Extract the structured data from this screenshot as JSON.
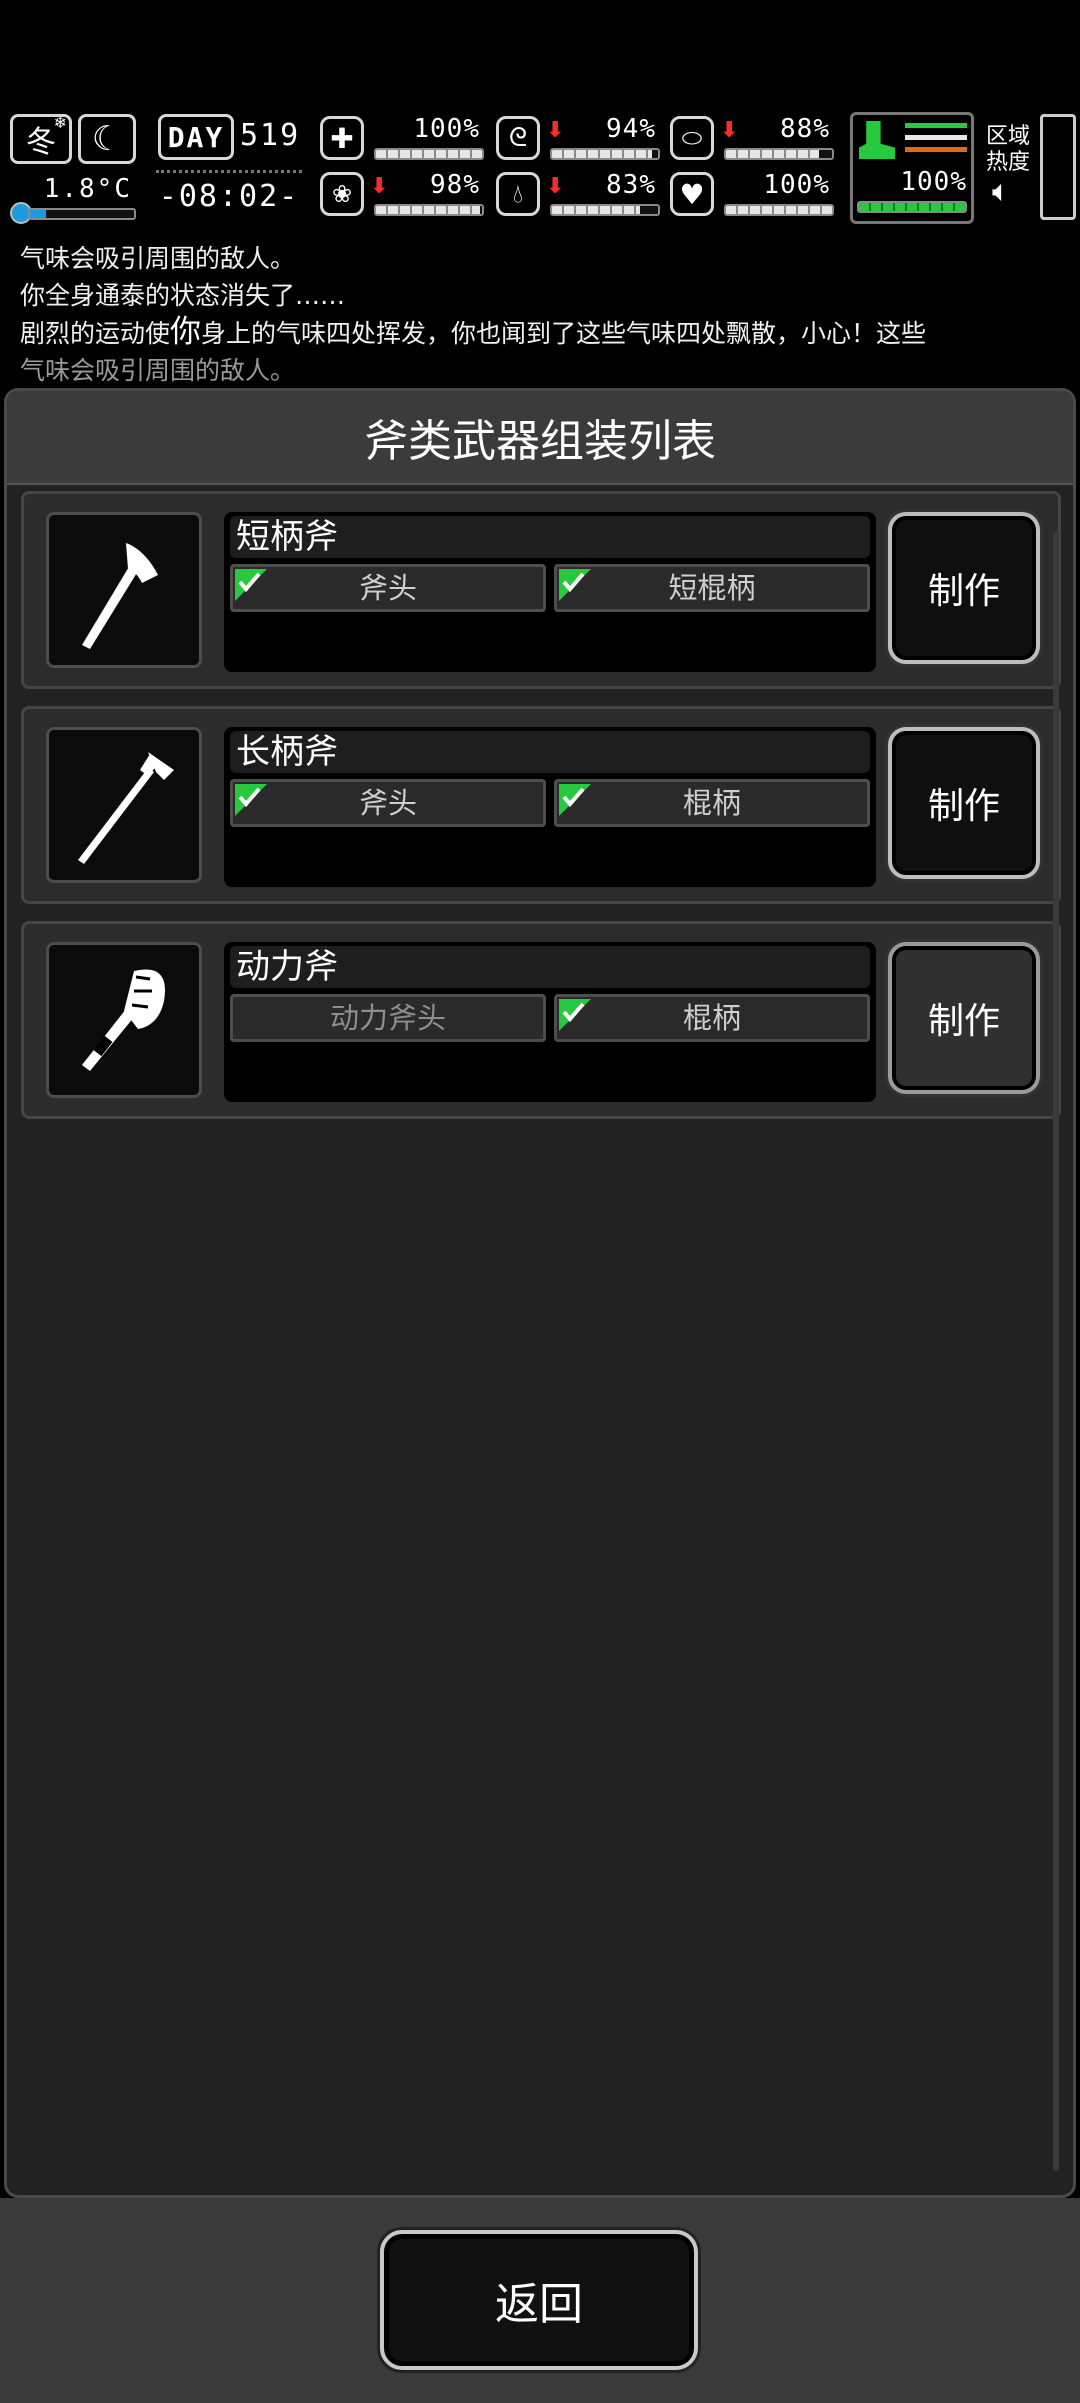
{
  "hud": {
    "season": "冬",
    "temperature": "1.8°C",
    "day_label": "DAY",
    "day_number": "519",
    "time": "-08:02-",
    "stats": [
      {
        "icon": "medkit-icon",
        "value": "100%",
        "level": 1.0,
        "down": false
      },
      {
        "icon": "stomach-icon",
        "value": "94%",
        "level": 0.94,
        "down": true
      },
      {
        "icon": "bladder-icon",
        "value": "88%",
        "level": 0.88,
        "down": true
      },
      {
        "icon": "brain-icon",
        "value": "98%",
        "level": 0.98,
        "down": true
      },
      {
        "icon": "water-drop-icon",
        "value": "83%",
        "level": 0.83,
        "down": true
      },
      {
        "icon": "heart-icon",
        "value": "100%",
        "level": 1.0,
        "down": false
      }
    ],
    "stamina_value": "100%",
    "stamina_level": 1.0,
    "temperature_level": 0.15,
    "area_heat_label_1": "区域",
    "area_heat_label_2": "热度"
  },
  "log": {
    "line1": "气味会吸引周围的敌人。",
    "line2": "你全身通泰的状态消失了……",
    "line3_a": "剧烈的运动使",
    "line3_b": "你",
    "line3_c": "身上的气味四处挥发，你也闻到了这些气味四处飘散，小心！这些",
    "line4": "气味会吸引周围的敌人。"
  },
  "panel": {
    "title": "斧类武器组装列表",
    "craft_label": "制作"
  },
  "recipes": [
    {
      "name": "短柄斧",
      "part1": "斧头",
      "part1_ok": true,
      "part2": "短棍柄",
      "part2_ok": true,
      "craftable": true,
      "icon": "hatchet-icon"
    },
    {
      "name": "长柄斧",
      "part1": "斧头",
      "part1_ok": true,
      "part2": "棍柄",
      "part2_ok": true,
      "craftable": true,
      "icon": "long-axe-icon"
    },
    {
      "name": "动力斧",
      "part1": "动力斧头",
      "part1_ok": false,
      "part2": "棍柄",
      "part2_ok": true,
      "craftable": false,
      "icon": "power-axe-icon"
    }
  ],
  "footer": {
    "back_label": "返回"
  },
  "colors": {
    "check_green": "#27c93f",
    "stamina_green": "#27c93f",
    "stamina_orange": "#e36a13",
    "alert_red": "#ff2a2a",
    "temp_blue": "#1b9be0"
  }
}
